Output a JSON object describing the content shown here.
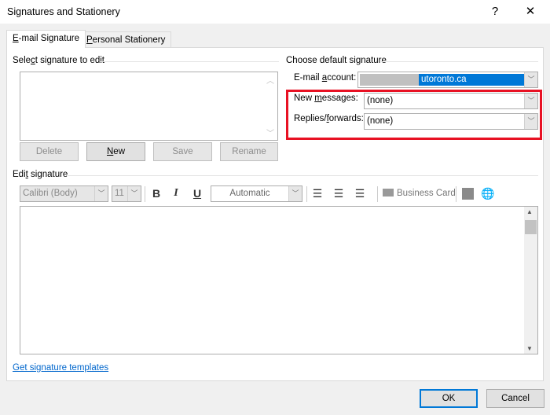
{
  "window": {
    "title": "Signatures and Stationery",
    "help": "?",
    "close": "✕"
  },
  "tabs": [
    {
      "label": "E-mail Signature",
      "u": "E",
      "rest": "-mail Signature"
    },
    {
      "label": "Personal Stationery",
      "u": "P",
      "rest": "ersonal Stationery"
    }
  ],
  "select_group": {
    "a": "Sele",
    "u": "c",
    "b": "t signature to edit"
  },
  "list_buttons": {
    "delete": "Delete",
    "new_u": "N",
    "new_rest": "ew",
    "save": "Save",
    "rename": "Rename"
  },
  "default_group": {
    "title": "Choose default signature",
    "account_a": "E-mail ",
    "account_u": "a",
    "account_b": "ccount:",
    "account_value": "utoronto.ca",
    "new_a": "New ",
    "new_u": "m",
    "new_b": "essages:",
    "new_value": "(none)",
    "replies_a": "Replies/",
    "replies_u": "f",
    "replies_b": "orwards:",
    "replies_value": "(none)"
  },
  "edit_group": {
    "a": "Edi",
    "u": "t",
    "b": " signature"
  },
  "toolbar": {
    "font": "Calibri (Body)",
    "size": "11",
    "bold": "B",
    "italic": "I",
    "underline": "U",
    "color": "Automatic",
    "business_card": "Business Card"
  },
  "templates_link": "Get signature templates",
  "footer": {
    "ok": "OK",
    "cancel": "Cancel"
  },
  "colors": {
    "highlight": "#e81123",
    "selection": "#0078d7",
    "link": "#0066cc"
  }
}
